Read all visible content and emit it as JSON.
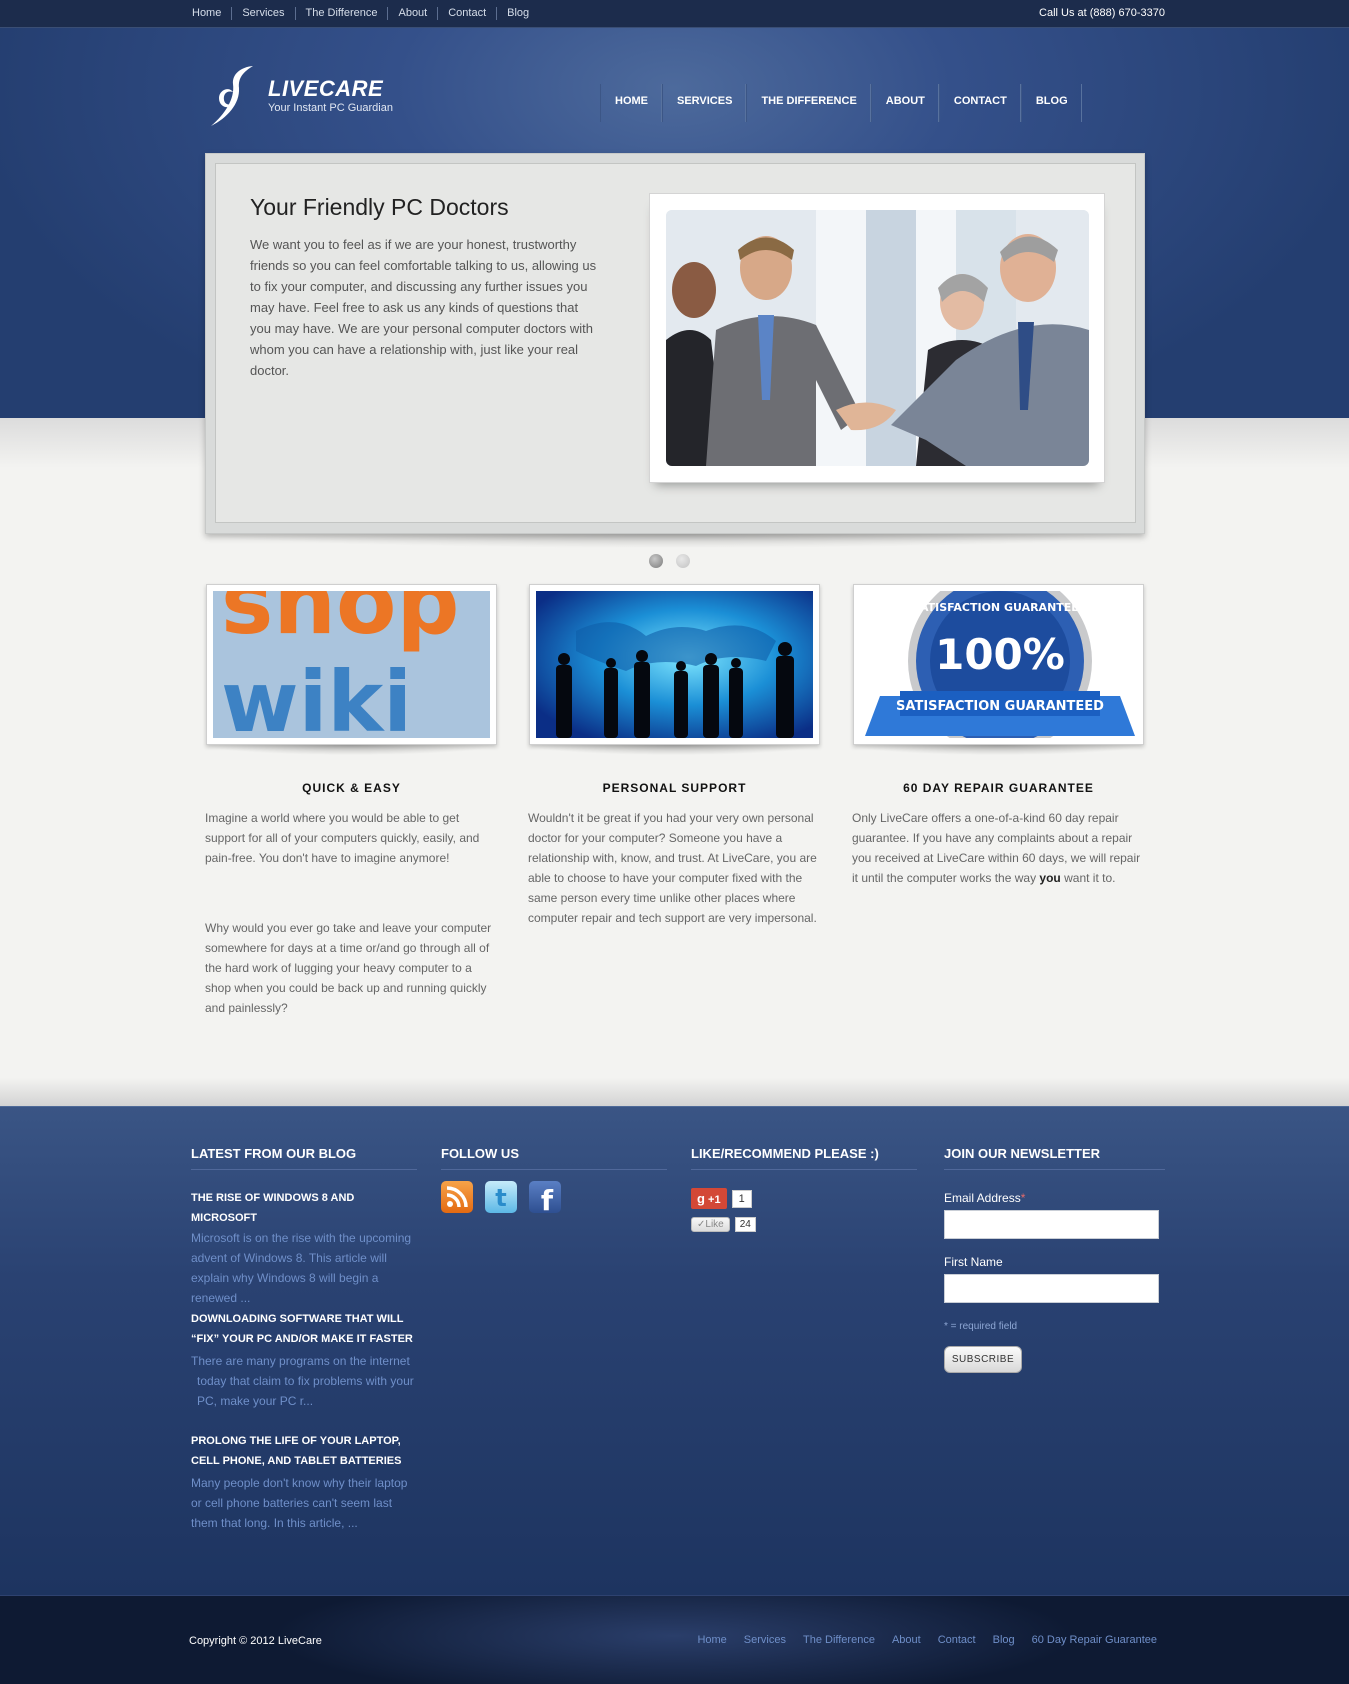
{
  "topbar": {
    "nav": [
      "Home",
      "Services",
      "The Difference",
      "About",
      "Contact",
      "Blog"
    ],
    "phone": "Call Us at (888) 670-3370"
  },
  "header": {
    "brand": "LIVECARE",
    "tagline": "Your Instant PC Guardian",
    "nav": [
      "HOME",
      "SERVICES",
      "THE DIFFERENCE",
      "ABOUT",
      "CONTACT",
      "BLOG"
    ]
  },
  "hero": {
    "title": "Your Friendly PC Doctors",
    "text": "We want you to feel as if we are your honest, trustworthy friends so you can feel comfortable talking to us, allowing us to fix your computer, and discussing any further issues you may have. Feel free to ask us any kinds of questions that you may have. We are your personal computer doctors with whom you can have a relationship with, just like your real doctor.",
    "slide_count": 2,
    "active_slide": 1
  },
  "features": [
    {
      "title": "QUICK & EASY",
      "image_text": [
        "shop",
        "wiki"
      ],
      "paragraphs": [
        "Imagine a world where you would be able to get support for all of your computers quickly, easily, and pain-free. You don't have to imagine anymore!",
        "Why would you ever go take and leave your computer somewhere for days at a time or/and go through all of the hard work of lugging your heavy computer to a shop when you could be back up and running quickly and painlessly?"
      ]
    },
    {
      "title": "PERSONAL SUPPORT",
      "paragraphs": [
        "Wouldn't it be great if you had your very own personal doctor for your computer? Someone you have a relationship with, know, and trust. At LiveCare, you are able to choose to have your computer fixed with the same person every time unlike other places where computer repair and tech support are very impersonal."
      ]
    },
    {
      "title": "60 DAY REPAIR GUARANTEE",
      "image_text": [
        "SATISFACTION GUARANTEED",
        "100%",
        "SATISFACTION GUARANTEED"
      ],
      "text_before": "Only LiveCare offers a one-of-a-kind 60 day repair guarantee. If you have any complaints about a repair you received at LiveCare within 60 days, we will repair it until the computer works the way ",
      "text_bold": "you",
      "text_after": " want it to."
    }
  ],
  "footer": {
    "blog": {
      "heading": "LATEST FROM OUR BLOG",
      "posts": [
        {
          "title": "THE RISE OF WINDOWS 8 AND MICROSOFT",
          "excerpt": "Microsoft is on the rise with the upcoming advent of Windows 8. This article will explain why Windows 8 will begin a renewed ..."
        },
        {
          "title": "DOWNLOADING SOFTWARE THAT WILL “FIX” YOUR PC AND/OR MAKE IT FASTER",
          "excerpt": "There are many programs on the internet today that claim to fix problems with your PC, make your PC r..."
        },
        {
          "title": "PROLONG THE LIFE OF YOUR LAPTOP, CELL PHONE, AND TABLET BATTERIES",
          "excerpt": "Many people don't know why their laptop or cell phone batteries can't seem last them that long. In this article, ..."
        }
      ]
    },
    "follow": {
      "heading": "FOLLOW US",
      "icons": [
        "rss-icon",
        "twitter-icon",
        "facebook-icon"
      ]
    },
    "like": {
      "heading": "LIKE/RECOMMEND PLEASE :)",
      "gplus_label": "+1",
      "gplus_count": "1",
      "like_label": "Like",
      "like_count": "24"
    },
    "newsletter": {
      "heading": "JOIN OUR NEWSLETTER",
      "email_label": "Email Address",
      "required_mark": "*",
      "first_name_label": "First Name",
      "required_note": "* = required field",
      "subscribe_label": "SUBSCRIBE"
    }
  },
  "bottom": {
    "copyright": "Copyright © 2012 LiveCare",
    "nav": [
      "Home",
      "Services",
      "The Difference",
      "About",
      "Contact",
      "Blog",
      "60 Day Repair Guarantee"
    ]
  },
  "colors": {
    "header_blue": "#34508a",
    "footer_link": "#6f8fc9",
    "topbar": "#1c2c4c"
  }
}
